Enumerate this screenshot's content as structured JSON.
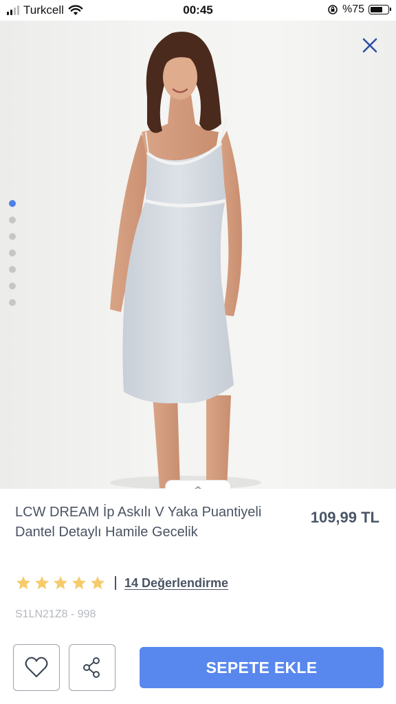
{
  "status_bar": {
    "carrier": "Turkcell",
    "time": "00:45",
    "battery": "%75",
    "battery_level": 0.75
  },
  "gallery": {
    "image_count": 7,
    "active_index": 0
  },
  "product": {
    "title": "LCW DREAM İp Askılı V Yaka Puantiyeli Dantel Detaylı Hamile Gecelik",
    "price": "109,99 TL",
    "rating": 5,
    "reviews_label": "14 Değerlendirme",
    "sku": "S1LN21Z8 - 998"
  },
  "actions": {
    "add_to_cart": "SEPETE EKLE"
  },
  "colors": {
    "accent": "#5887ed",
    "star": "#f6cb6b",
    "active_dot": "#4d7fe6",
    "close_icon": "#2d4fa3"
  }
}
